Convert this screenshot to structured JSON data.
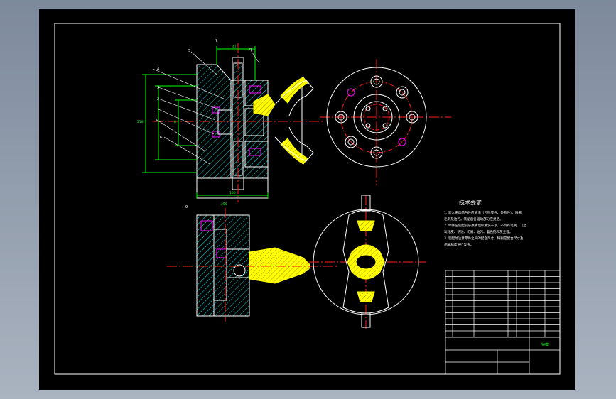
{
  "drawing": {
    "title": "技术要求",
    "notes": [
      "1. 装入夹具前各件应清洗（包括零件、外购件），除去",
      "   毛刺及油污。装配后各运动部分应灵活。",
      "2. 零件在装配前必须清理和清洗干净，不得有毛刺、飞边、",
      "   氧化皮、锈蚀、切屑、油污、着色剂和灰尘等。",
      "3. 装配时注意零件之间的配合尺寸，特别是配合尺寸及",
      "   相关精度进行复查。"
    ],
    "title_block_name": "钻模",
    "balloon_labels": [
      "5",
      "7",
      "8",
      "4",
      "3",
      "2",
      "1",
      "6"
    ],
    "bottom_balloon": "9",
    "dim_labels": [
      "47",
      "100",
      "218",
      "256",
      "8"
    ]
  },
  "colors": {
    "background": "#000000",
    "outline": "#ffffff",
    "dimension": "#00ff00",
    "centerline": "#ff2020",
    "hatch": "#00c8c8",
    "yellow_part": "#ffff00",
    "magenta": "#ff00ff",
    "viewport": "#8e9aab"
  }
}
